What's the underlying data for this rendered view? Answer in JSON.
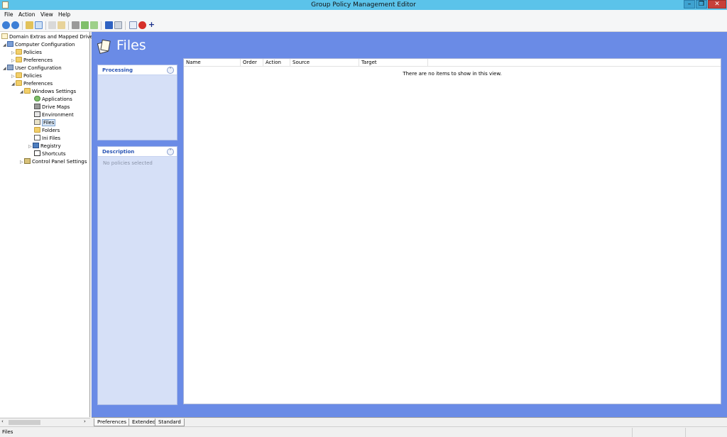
{
  "window": {
    "title": "Group Policy Management Editor",
    "min": "–",
    "max": "❐",
    "close": "✕"
  },
  "menu": [
    "File",
    "Action",
    "View",
    "Help"
  ],
  "tree": {
    "root": "Domain Extras and Mapped Drives",
    "computer_configuration": "Computer Configuration",
    "cc_policies": "Policies",
    "cc_preferences": "Preferences",
    "user_configuration": "User Configuration",
    "uc_policies": "Policies",
    "uc_preferences": "Preferences",
    "windows_settings": "Windows Settings",
    "applications": "Applications",
    "drive_maps": "Drive Maps",
    "environment": "Environment",
    "files": "Files",
    "folders": "Folders",
    "ini_files": "Ini Files",
    "registry": "Registry",
    "shortcuts": "Shortcuts",
    "control_panel_settings": "Control Panel Settings"
  },
  "main": {
    "title": "Files",
    "processing_label": "Processing",
    "description_label": "Description",
    "description_text": "No policies selected",
    "columns": [
      "Name",
      "Order",
      "Action",
      "Source",
      "Target"
    ],
    "empty_message": "There are no items to show in this view."
  },
  "tabs": [
    "Preferences",
    "Extended",
    "Standard"
  ],
  "status": {
    "text": "Files"
  },
  "colors": {
    "titlebar": "#5bc3ea",
    "content_bg": "#6a8be6",
    "panel_bg": "#d6e0f7",
    "close": "#c7403a"
  }
}
